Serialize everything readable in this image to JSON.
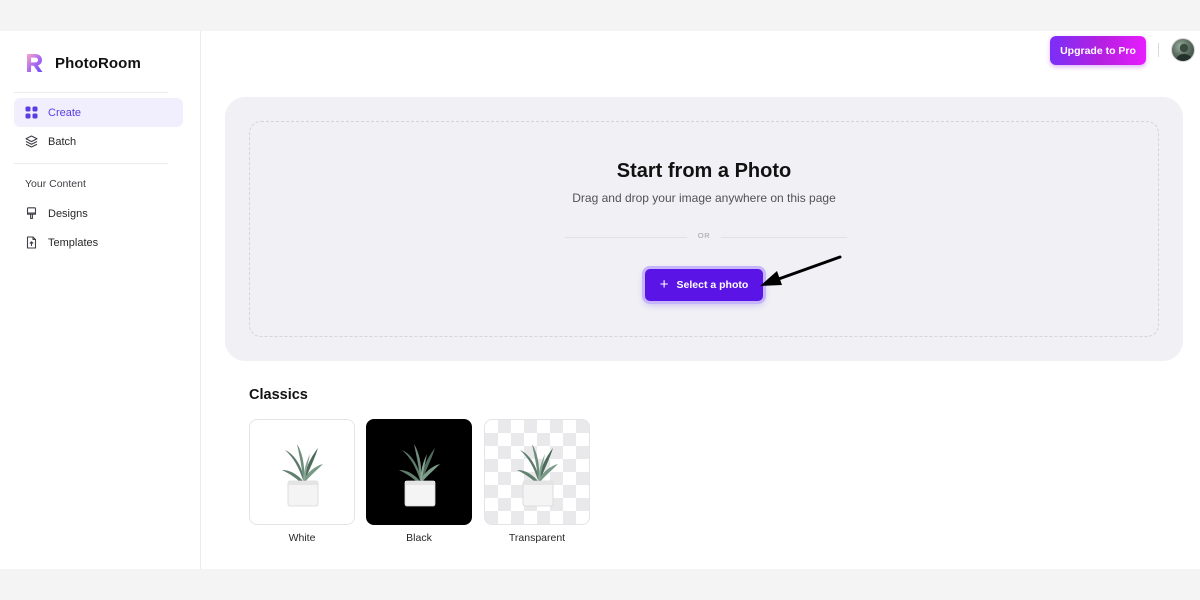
{
  "brand": {
    "name": "PhotoRoom",
    "logo_icon": "photoroom-logo-icon"
  },
  "sidebar": {
    "items": [
      {
        "label": "Create",
        "icon": "grid-icon",
        "active": true
      },
      {
        "label": "Batch",
        "icon": "layers-icon",
        "active": false
      }
    ],
    "section_label": "Your Content",
    "content_items": [
      {
        "label": "Designs",
        "icon": "brush-icon"
      },
      {
        "label": "Templates",
        "icon": "template-icon"
      }
    ]
  },
  "header": {
    "upgrade_label": "Upgrade to Pro",
    "avatar_icon": "user-avatar"
  },
  "upload": {
    "title": "Start from a Photo",
    "subtitle": "Drag and drop your image anywhere on this page",
    "or_label": "OR",
    "select_label": "Select a photo",
    "select_icon": "plus-icon"
  },
  "classics": {
    "title": "Classics",
    "tiles": [
      {
        "label": "White",
        "background": "#ffffff"
      },
      {
        "label": "Black",
        "background": "#000000"
      },
      {
        "label": "Transparent",
        "background": "checkerboard"
      }
    ]
  },
  "colors": {
    "accent": "#5a14e6",
    "active_nav_bg": "#f1effd",
    "upgrade_gradient_start": "#7b2ff7",
    "upgrade_gradient_end": "#e81cff",
    "dropzone_bg": "#f0f0f5"
  }
}
